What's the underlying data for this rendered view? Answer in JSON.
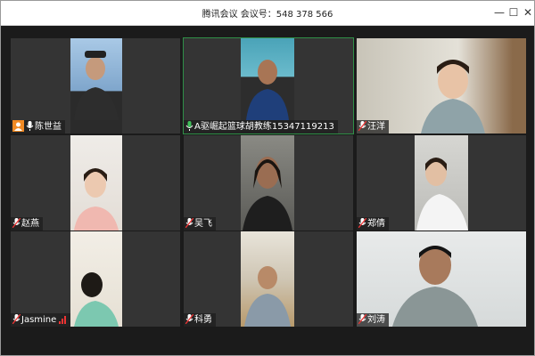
{
  "window": {
    "title": "腾讯会议  会议号：548 378 566",
    "controls": {
      "minimize": "—",
      "maximize": "☐",
      "close": "✕"
    }
  },
  "participants": [
    {
      "name": "陈世益",
      "host": true
    },
    {
      "name": "A驱崛起篮球胡教练15347119213",
      "active": true
    },
    {
      "name": "汪洋"
    },
    {
      "name": "赵燕"
    },
    {
      "name": "吴飞"
    },
    {
      "name": "郑倩"
    },
    {
      "name": "Jasmine",
      "signal": true
    },
    {
      "name": "科勇"
    },
    {
      "name": "刘涛"
    }
  ],
  "colors": {
    "accent_green": "#2f8f47",
    "host_orange": "#f08a24"
  }
}
